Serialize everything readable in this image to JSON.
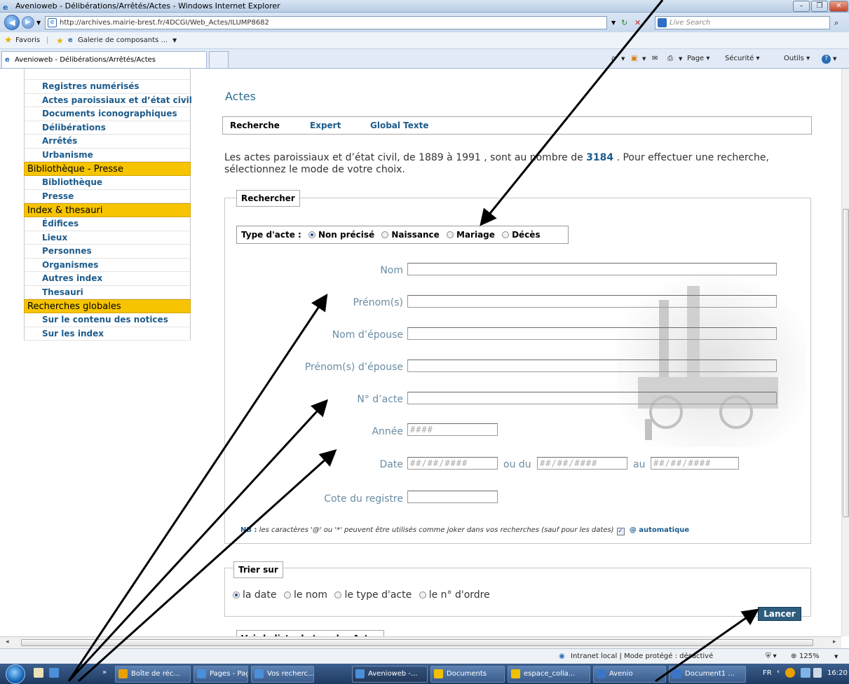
{
  "window": {
    "title": "Avenioweb - Délibérations/Arrêtés/Actes - Windows Internet Explorer",
    "min": "–",
    "max": "❐",
    "close": "✕"
  },
  "browser": {
    "url": "http://archives.mairie-brest.fr/4DCGI/Web_Actes/ILUMP8682",
    "search_placeholder": "Live Search",
    "favorites": "Favoris",
    "gallery": "Galerie de composants ...",
    "tab_title": "Avenioweb - Délibérations/Arrêtés/Actes",
    "page_menu": "Page",
    "security_menu": "Sécurité",
    "tools_menu": "Outils"
  },
  "sidebar": {
    "group1": [
      "Registres numérisés",
      "Actes paroissiaux et d’état civil",
      "Documents iconographiques",
      "Délibérations",
      "Arrêtés",
      "Urbanisme"
    ],
    "head2": "Bibliothèque - Presse",
    "group2": [
      "Bibliothèque",
      "Presse"
    ],
    "head3": "Index & thesauri",
    "group3": [
      "Édifices",
      "Lieux",
      "Personnes",
      "Organismes",
      "Autres index",
      "Thesauri"
    ],
    "head4": "Recherches globales",
    "group4": [
      "Sur le contenu des notices",
      "Sur les index"
    ]
  },
  "main": {
    "title": "Actes",
    "tabs": [
      "Recherche",
      "Expert",
      "Global Texte"
    ],
    "intro_a": "Les actes paroissiaux et d’état civil, de 1889 à 1991 , sont au nombre de ",
    "intro_count": "3184",
    "intro_b": " . Pour effectuer une recherche, sélectionnez le mode de votre choix.",
    "search_legend": "Rechercher",
    "type_label": "Type d'acte :",
    "types": [
      "Non précisé",
      "Naissance",
      "Mariage",
      "Décès"
    ],
    "fields": {
      "nom": "Nom",
      "prenom": "Prénom(s)",
      "nom_epouse": "Nom d’épouse",
      "prenom_epouse": "Prénom(s) d’épouse",
      "num_acte": "N° d’acte",
      "annee": "Année",
      "annee_ph": "####",
      "date": "Date",
      "date_ph": "##/##/####",
      "ou_du": "ou du",
      "au": "au",
      "cote": "Cote du registre"
    },
    "nb_label": "NB :",
    "nb_text": " les caractères '@' ou '*' peuvent être utilisés comme joker dans vos recherches (sauf pour les dates)",
    "auto": "@ automatique",
    "sort_legend": "Trier sur",
    "sort_options": [
      "la date",
      "le nom",
      "le type d'acte",
      "le n° d'ordre"
    ],
    "submit": "Lancer",
    "list_legend": "Voir la liste de tous les Actes"
  },
  "status": {
    "zone": "Intranet local | Mode protégé : désactivé",
    "zoom": "125%"
  },
  "taskbar": {
    "items": [
      "Boîte de réc...",
      "Pages - Pag...",
      "Vos recherc...",
      "Avenioweb -...",
      "Documents",
      "espace_colla...",
      "Avenio",
      "Document1 ..."
    ],
    "lang": "FR",
    "clock": "16:20"
  }
}
